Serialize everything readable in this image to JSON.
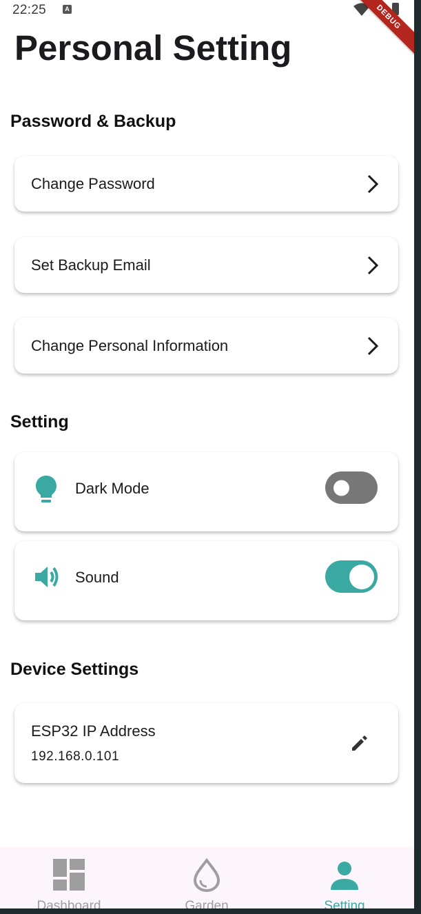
{
  "status_bar": {
    "time": "22:25",
    "notification_badge": "A",
    "debug_ribbon": "DEBUG"
  },
  "page": {
    "title": "Personal Setting"
  },
  "sections": {
    "password_backup": {
      "heading": "Password & Backup",
      "items": [
        {
          "label": "Change Password",
          "icon": "chevron-right-icon"
        },
        {
          "label": "Set Backup Email",
          "icon": "chevron-right-icon"
        },
        {
          "label": "Change Personal Information",
          "icon": "chevron-right-icon"
        }
      ]
    },
    "setting": {
      "heading": "Setting",
      "items": [
        {
          "label": "Dark Mode",
          "icon": "lightbulb-icon",
          "enabled": false
        },
        {
          "label": "Sound",
          "icon": "speaker-icon",
          "enabled": true
        }
      ]
    },
    "device": {
      "heading": "Device Settings",
      "ip_label": "ESP32 IP Address",
      "ip_value": "192.168.0.101",
      "edit_icon": "pencil-icon"
    }
  },
  "nav": {
    "items": [
      {
        "label": "Dashboard",
        "icon": "dashboard-icon",
        "active": false
      },
      {
        "label": "Garden",
        "icon": "water-drop-icon",
        "active": false
      },
      {
        "label": "Setting",
        "icon": "person-icon",
        "active": true
      }
    ]
  },
  "colors": {
    "accent": "#3aa9a1",
    "toggle_off": "#777777",
    "nav_background": "#fcf5fb",
    "nav_inactive": "#9e9e9e"
  }
}
